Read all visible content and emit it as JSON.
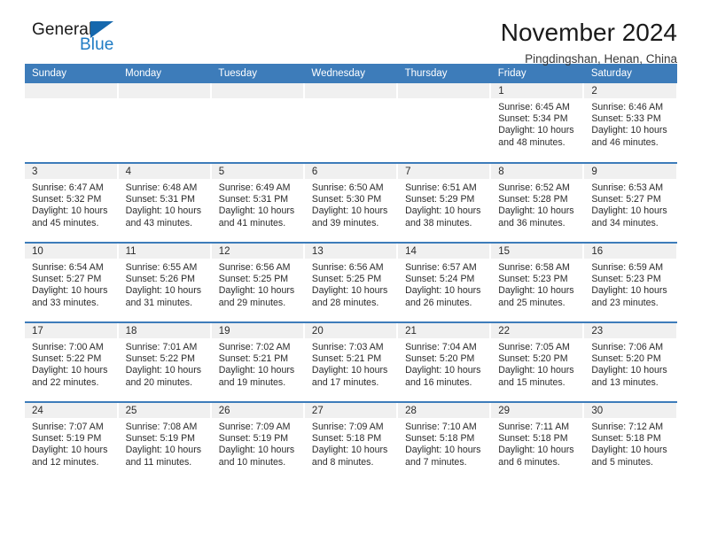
{
  "brand": {
    "name_top": "General",
    "name_bottom": "Blue",
    "triangle_icon": "triangle-icon",
    "accent_color": "#1668ad"
  },
  "header": {
    "title": "November 2024",
    "subtitle": "Pingdingshan, Henan, China"
  },
  "theme": {
    "header_row_bg": "#3d7cba",
    "daynum_band_bg": "#f0f0f0",
    "cell_bg": "#ffffff",
    "row_divider": "#3d7cba",
    "text": "#2b2b2b"
  },
  "weekday_headers": [
    "Sunday",
    "Monday",
    "Tuesday",
    "Wednesday",
    "Thursday",
    "Friday",
    "Saturday"
  ],
  "labels": {
    "sunrise_prefix": "Sunrise:",
    "sunset_prefix": "Sunset:",
    "daylight_prefix": "Daylight:"
  },
  "weeks": [
    [
      {
        "blank": true
      },
      {
        "blank": true
      },
      {
        "blank": true
      },
      {
        "blank": true
      },
      {
        "blank": true
      },
      {
        "day": "1",
        "sunrise": "Sunrise: 6:45 AM",
        "sunset": "Sunset: 5:34 PM",
        "daylight_line1": "Daylight: 10 hours",
        "daylight_line2": "and 48 minutes."
      },
      {
        "day": "2",
        "sunrise": "Sunrise: 6:46 AM",
        "sunset": "Sunset: 5:33 PM",
        "daylight_line1": "Daylight: 10 hours",
        "daylight_line2": "and 46 minutes."
      }
    ],
    [
      {
        "day": "3",
        "sunrise": "Sunrise: 6:47 AM",
        "sunset": "Sunset: 5:32 PM",
        "daylight_line1": "Daylight: 10 hours",
        "daylight_line2": "and 45 minutes."
      },
      {
        "day": "4",
        "sunrise": "Sunrise: 6:48 AM",
        "sunset": "Sunset: 5:31 PM",
        "daylight_line1": "Daylight: 10 hours",
        "daylight_line2": "and 43 minutes."
      },
      {
        "day": "5",
        "sunrise": "Sunrise: 6:49 AM",
        "sunset": "Sunset: 5:31 PM",
        "daylight_line1": "Daylight: 10 hours",
        "daylight_line2": "and 41 minutes."
      },
      {
        "day": "6",
        "sunrise": "Sunrise: 6:50 AM",
        "sunset": "Sunset: 5:30 PM",
        "daylight_line1": "Daylight: 10 hours",
        "daylight_line2": "and 39 minutes."
      },
      {
        "day": "7",
        "sunrise": "Sunrise: 6:51 AM",
        "sunset": "Sunset: 5:29 PM",
        "daylight_line1": "Daylight: 10 hours",
        "daylight_line2": "and 38 minutes."
      },
      {
        "day": "8",
        "sunrise": "Sunrise: 6:52 AM",
        "sunset": "Sunset: 5:28 PM",
        "daylight_line1": "Daylight: 10 hours",
        "daylight_line2": "and 36 minutes."
      },
      {
        "day": "9",
        "sunrise": "Sunrise: 6:53 AM",
        "sunset": "Sunset: 5:27 PM",
        "daylight_line1": "Daylight: 10 hours",
        "daylight_line2": "and 34 minutes."
      }
    ],
    [
      {
        "day": "10",
        "sunrise": "Sunrise: 6:54 AM",
        "sunset": "Sunset: 5:27 PM",
        "daylight_line1": "Daylight: 10 hours",
        "daylight_line2": "and 33 minutes."
      },
      {
        "day": "11",
        "sunrise": "Sunrise: 6:55 AM",
        "sunset": "Sunset: 5:26 PM",
        "daylight_line1": "Daylight: 10 hours",
        "daylight_line2": "and 31 minutes."
      },
      {
        "day": "12",
        "sunrise": "Sunrise: 6:56 AM",
        "sunset": "Sunset: 5:25 PM",
        "daylight_line1": "Daylight: 10 hours",
        "daylight_line2": "and 29 minutes."
      },
      {
        "day": "13",
        "sunrise": "Sunrise: 6:56 AM",
        "sunset": "Sunset: 5:25 PM",
        "daylight_line1": "Daylight: 10 hours",
        "daylight_line2": "and 28 minutes."
      },
      {
        "day": "14",
        "sunrise": "Sunrise: 6:57 AM",
        "sunset": "Sunset: 5:24 PM",
        "daylight_line1": "Daylight: 10 hours",
        "daylight_line2": "and 26 minutes."
      },
      {
        "day": "15",
        "sunrise": "Sunrise: 6:58 AM",
        "sunset": "Sunset: 5:23 PM",
        "daylight_line1": "Daylight: 10 hours",
        "daylight_line2": "and 25 minutes."
      },
      {
        "day": "16",
        "sunrise": "Sunrise: 6:59 AM",
        "sunset": "Sunset: 5:23 PM",
        "daylight_line1": "Daylight: 10 hours",
        "daylight_line2": "and 23 minutes."
      }
    ],
    [
      {
        "day": "17",
        "sunrise": "Sunrise: 7:00 AM",
        "sunset": "Sunset: 5:22 PM",
        "daylight_line1": "Daylight: 10 hours",
        "daylight_line2": "and 22 minutes."
      },
      {
        "day": "18",
        "sunrise": "Sunrise: 7:01 AM",
        "sunset": "Sunset: 5:22 PM",
        "daylight_line1": "Daylight: 10 hours",
        "daylight_line2": "and 20 minutes."
      },
      {
        "day": "19",
        "sunrise": "Sunrise: 7:02 AM",
        "sunset": "Sunset: 5:21 PM",
        "daylight_line1": "Daylight: 10 hours",
        "daylight_line2": "and 19 minutes."
      },
      {
        "day": "20",
        "sunrise": "Sunrise: 7:03 AM",
        "sunset": "Sunset: 5:21 PM",
        "daylight_line1": "Daylight: 10 hours",
        "daylight_line2": "and 17 minutes."
      },
      {
        "day": "21",
        "sunrise": "Sunrise: 7:04 AM",
        "sunset": "Sunset: 5:20 PM",
        "daylight_line1": "Daylight: 10 hours",
        "daylight_line2": "and 16 minutes."
      },
      {
        "day": "22",
        "sunrise": "Sunrise: 7:05 AM",
        "sunset": "Sunset: 5:20 PM",
        "daylight_line1": "Daylight: 10 hours",
        "daylight_line2": "and 15 minutes."
      },
      {
        "day": "23",
        "sunrise": "Sunrise: 7:06 AM",
        "sunset": "Sunset: 5:20 PM",
        "daylight_line1": "Daylight: 10 hours",
        "daylight_line2": "and 13 minutes."
      }
    ],
    [
      {
        "day": "24",
        "sunrise": "Sunrise: 7:07 AM",
        "sunset": "Sunset: 5:19 PM",
        "daylight_line1": "Daylight: 10 hours",
        "daylight_line2": "and 12 minutes."
      },
      {
        "day": "25",
        "sunrise": "Sunrise: 7:08 AM",
        "sunset": "Sunset: 5:19 PM",
        "daylight_line1": "Daylight: 10 hours",
        "daylight_line2": "and 11 minutes."
      },
      {
        "day": "26",
        "sunrise": "Sunrise: 7:09 AM",
        "sunset": "Sunset: 5:19 PM",
        "daylight_line1": "Daylight: 10 hours",
        "daylight_line2": "and 10 minutes."
      },
      {
        "day": "27",
        "sunrise": "Sunrise: 7:09 AM",
        "sunset": "Sunset: 5:18 PM",
        "daylight_line1": "Daylight: 10 hours",
        "daylight_line2": "and 8 minutes."
      },
      {
        "day": "28",
        "sunrise": "Sunrise: 7:10 AM",
        "sunset": "Sunset: 5:18 PM",
        "daylight_line1": "Daylight: 10 hours",
        "daylight_line2": "and 7 minutes."
      },
      {
        "day": "29",
        "sunrise": "Sunrise: 7:11 AM",
        "sunset": "Sunset: 5:18 PM",
        "daylight_line1": "Daylight: 10 hours",
        "daylight_line2": "and 6 minutes."
      },
      {
        "day": "30",
        "sunrise": "Sunrise: 7:12 AM",
        "sunset": "Sunset: 5:18 PM",
        "daylight_line1": "Daylight: 10 hours",
        "daylight_line2": "and 5 minutes."
      }
    ]
  ]
}
